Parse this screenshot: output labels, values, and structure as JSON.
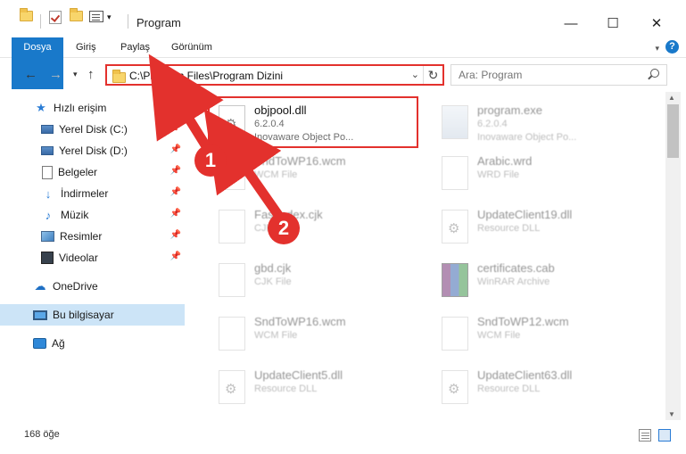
{
  "window": {
    "title": "Program"
  },
  "ribbon": {
    "tabs": [
      "Dosya",
      "Giriş",
      "Paylaş",
      "Görünüm"
    ],
    "help": "?"
  },
  "address": {
    "path": "C:\\Program Files\\Program Dizini"
  },
  "search": {
    "placeholder": "Ara: Program"
  },
  "sidebar": {
    "items": [
      {
        "label": "Hızlı erişim",
        "icon": "star-icon"
      },
      {
        "label": "Yerel Disk (C:)",
        "icon": "disk-icon",
        "pinned": true
      },
      {
        "label": "Yerel Disk (D:)",
        "icon": "disk-icon",
        "pinned": true
      },
      {
        "label": "Belgeler",
        "icon": "documents-icon",
        "pinned": true
      },
      {
        "label": "İndirmeler",
        "icon": "download-icon",
        "pinned": true
      },
      {
        "label": "Müzik",
        "icon": "music-icon",
        "pinned": true
      },
      {
        "label": "Resimler",
        "icon": "pictures-icon",
        "pinned": true
      },
      {
        "label": "Videolar",
        "icon": "videos-icon",
        "pinned": true
      },
      {
        "label": "OneDrive",
        "icon": "cloud-icon"
      },
      {
        "label": "Bu bilgisayar",
        "icon": "computer-icon",
        "selected": true
      },
      {
        "label": "Ağ",
        "icon": "network-icon"
      }
    ]
  },
  "files": [
    {
      "name": "objpool.dll",
      "line1": "6.2.0.4",
      "line2": "Inovaware Object Po...",
      "type": "dll",
      "highlighted": true
    },
    {
      "name": "program.exe",
      "line1": "6.2.0.4",
      "line2": "Inovaware Object Po...",
      "type": "exe"
    },
    {
      "name": "SndToWP16.wcm",
      "line1": "WCM File",
      "line2": "",
      "type": "doc"
    },
    {
      "name": "Arabic.wrd",
      "line1": "WRD File",
      "line2": "",
      "type": "doc"
    },
    {
      "name": "FastIndex.cjk",
      "line1": "CJK File",
      "line2": "",
      "type": "doc"
    },
    {
      "name": "UpdateClient19.dll",
      "line1": "Resource DLL",
      "line2": "",
      "type": "dll"
    },
    {
      "name": "gbd.cjk",
      "line1": "CJK File",
      "line2": "",
      "type": "doc"
    },
    {
      "name": "certificates.cab",
      "line1": "WinRAR Archive",
      "line2": "",
      "type": "rar"
    },
    {
      "name": "SndToWP16.wcm",
      "line1": "WCM File",
      "line2": "",
      "type": "doc"
    },
    {
      "name": "SndToWP12.wcm",
      "line1": "WCM File",
      "line2": "",
      "type": "doc"
    },
    {
      "name": "UpdateClient5.dll",
      "line1": "Resource DLL",
      "line2": "",
      "type": "dll"
    },
    {
      "name": "UpdateClient63.dll",
      "line1": "Resource DLL",
      "line2": "",
      "type": "dll"
    }
  ],
  "annotations": {
    "step1": "1",
    "step2": "2",
    "accent": "#e3312d"
  },
  "status": {
    "count": "168 öğe"
  }
}
